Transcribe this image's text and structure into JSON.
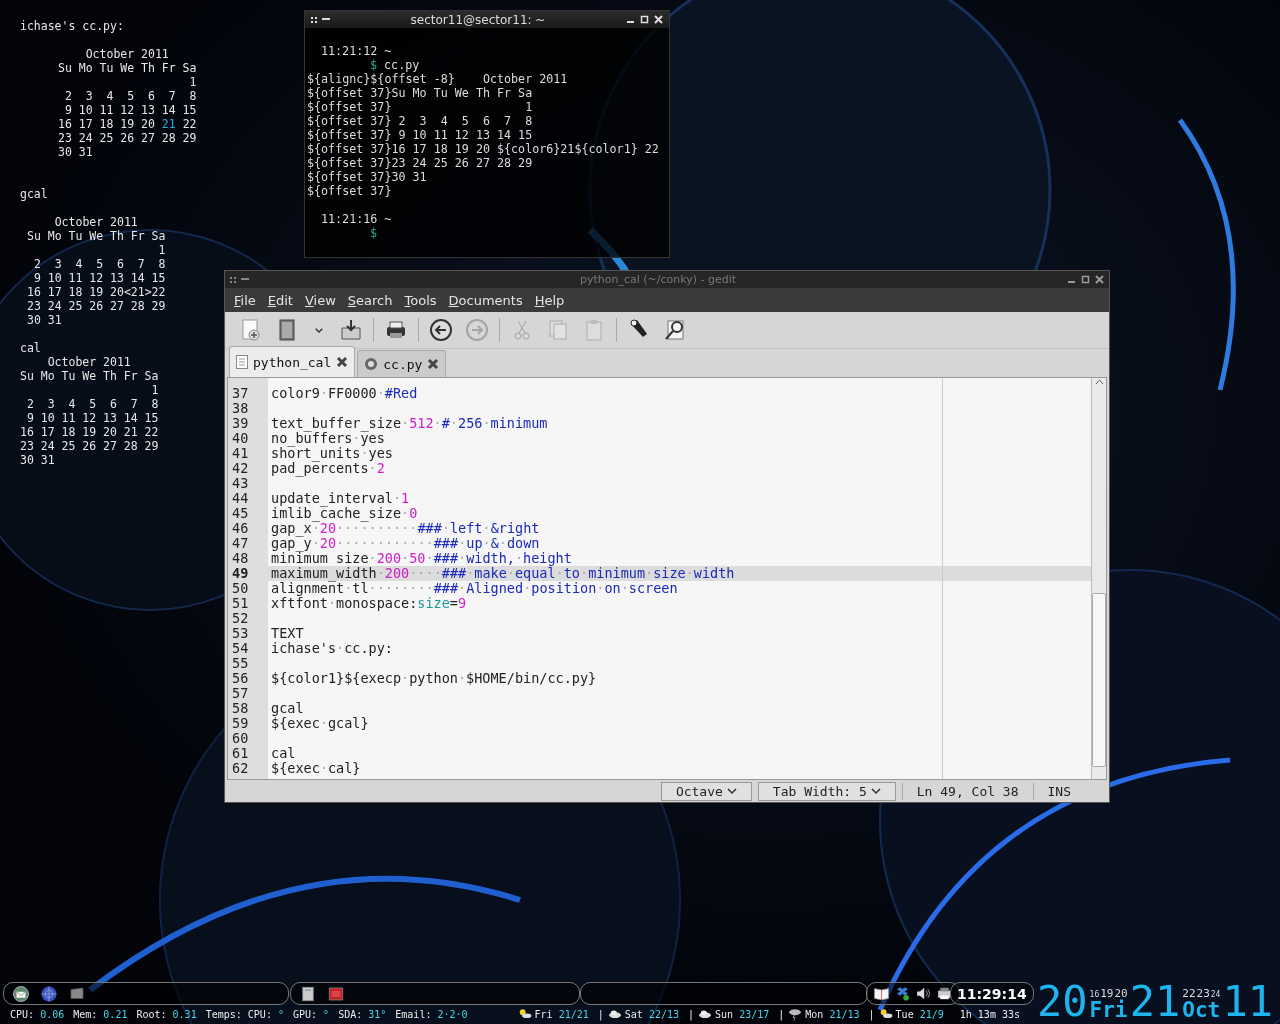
{
  "conky": {
    "sections": [
      {
        "title": "ichase's cc.py:",
        "calendar": [
          [
            "    October 2011"
          ],
          [
            "Su Mo Tu We Th Fr Sa"
          ],
          [
            "                   1"
          ],
          [
            " 2  3  4  5  6  7  8"
          ],
          [
            " 9 10 11 12 13 14 15"
          ],
          [
            {
              "text": "16 17 18 19 20 ",
              "highlight": false
            },
            {
              "text": "21",
              "highlight": true
            },
            {
              "text": " 22",
              "highlight": false
            }
          ],
          [
            "23 24 25 26 27 28 29"
          ],
          [
            "30 31"
          ]
        ]
      },
      {
        "title": "gcal",
        "calendar": [
          [
            "    October 2011"
          ],
          [
            "Su Mo Tu We Th Fr Sa"
          ],
          [
            "                   1"
          ],
          [
            " 2  3  4  5  6  7  8"
          ],
          [
            " 9 10 11 12 13 14 15"
          ],
          [
            "16 17 18 19 20<21>22"
          ],
          [
            "23 24 25 26 27 28 29"
          ],
          [
            "30 31"
          ]
        ]
      },
      {
        "title": "cal",
        "calendar": [
          [
            "    October 2011"
          ],
          [
            "Su Mo Tu We Th Fr Sa"
          ],
          [
            "                   1"
          ],
          [
            " 2  3  4  5  6  7  8"
          ],
          [
            " 9 10 11 12 13 14 15"
          ],
          [
            "16 17 18 19 20 21 22"
          ],
          [
            "23 24 25 26 27 28 29"
          ],
          [
            "30 31"
          ]
        ]
      }
    ]
  },
  "terminal": {
    "title": "sector11@sector11: ~",
    "lines": [
      {
        "kind": "blank"
      },
      {
        "kind": "time",
        "text": "11:21:12 ~"
      },
      {
        "kind": "prompt",
        "prompt": "$",
        "text": "cc.py"
      },
      {
        "kind": "output",
        "text": "${alignc}${offset -8}    October 2011"
      },
      {
        "kind": "output",
        "text": "${offset 37}Su Mo Tu We Th Fr Sa"
      },
      {
        "kind": "output",
        "text": "${offset 37}                   1"
      },
      {
        "kind": "output",
        "text": "${offset 37} 2  3  4  5  6  7  8"
      },
      {
        "kind": "output",
        "text": "${offset 37} 9 10 11 12 13 14 15"
      },
      {
        "kind": "output",
        "text": "${offset 37}16 17 18 19 20 ${color6}21${color1} 22"
      },
      {
        "kind": "output",
        "text": "${offset 37}23 24 25 26 27 28 29"
      },
      {
        "kind": "output",
        "text": "${offset 37}30 31"
      },
      {
        "kind": "output",
        "text": "${offset 37}"
      },
      {
        "kind": "blank"
      },
      {
        "kind": "time",
        "text": "11:21:16 ~"
      },
      {
        "kind": "prompt",
        "prompt": "$"
      }
    ]
  },
  "gedit": {
    "title": "python_cal (~/conky) - gedit",
    "menus": [
      "File",
      "Edit",
      "View",
      "Search",
      "Tools",
      "Documents",
      "Help"
    ],
    "toolbar": [
      [
        {
          "kind": "new",
          "disabled": false
        },
        {
          "kind": "open",
          "disabled": false
        },
        {
          "kind": "dropdown",
          "disabled": false
        },
        {
          "kind": "save",
          "disabled": false
        }
      ],
      [
        {
          "kind": "print",
          "disabled": false
        }
      ],
      [
        {
          "kind": "undo",
          "disabled": false
        },
        {
          "kind": "redo",
          "disabled": true
        }
      ],
      [
        {
          "kind": "cut",
          "disabled": true
        },
        {
          "kind": "copy",
          "disabled": true
        },
        {
          "kind": "paste",
          "disabled": true
        }
      ],
      [
        {
          "kind": "find",
          "disabled": false
        },
        {
          "kind": "replace",
          "disabled": false
        }
      ]
    ],
    "tabs": [
      {
        "label": "python_cal",
        "kind": "text",
        "selected": true
      },
      {
        "label": "cc.py",
        "kind": "python",
        "selected": false
      }
    ],
    "lines": [
      {
        "number": "37",
        "current": false,
        "tokens": [
          {
            "kind": "plain",
            "text": "color9·FF0000·"
          },
          {
            "kind": "comment",
            "text": "#Red"
          }
        ]
      },
      {
        "number": "38",
        "current": false
      },
      {
        "number": "39",
        "current": false,
        "tokens": [
          {
            "kind": "plain",
            "text": "text_buffer_size·"
          },
          {
            "kind": "number",
            "text": "512"
          },
          {
            "kind": "plain",
            "text": "·"
          },
          {
            "kind": "comment",
            "text": "#·256·minimum"
          }
        ]
      },
      {
        "number": "40",
        "current": false,
        "tokens": [
          {
            "kind": "plain",
            "text": "no_buffers·yes"
          }
        ]
      },
      {
        "number": "41",
        "current": false,
        "tokens": [
          {
            "kind": "plain",
            "text": "short_units·yes"
          }
        ]
      },
      {
        "number": "42",
        "current": false,
        "tokens": [
          {
            "kind": "plain",
            "text": "pad_percents·"
          },
          {
            "kind": "number",
            "text": "2"
          }
        ]
      },
      {
        "number": "43",
        "current": false
      },
      {
        "number": "44",
        "current": false,
        "tokens": [
          {
            "kind": "plain",
            "text": "update_interval·"
          },
          {
            "kind": "number",
            "text": "1"
          }
        ]
      },
      {
        "number": "45",
        "current": false,
        "tokens": [
          {
            "kind": "plain",
            "text": "imlib_cache_size·"
          },
          {
            "kind": "number",
            "text": "0"
          }
        ]
      },
      {
        "number": "46",
        "current": false,
        "tokens": [
          {
            "kind": "plain",
            "text": "gap_x·"
          },
          {
            "kind": "number",
            "text": "20"
          },
          {
            "kind": "plain",
            "text": "··········"
          },
          {
            "kind": "comment",
            "text": "###·left·&right"
          }
        ]
      },
      {
        "number": "47",
        "current": false,
        "tokens": [
          {
            "kind": "plain",
            "text": "gap_y·"
          },
          {
            "kind": "number",
            "text": "20"
          },
          {
            "kind": "plain",
            "text": "············"
          },
          {
            "kind": "comment",
            "text": "###·up·&·down"
          }
        ]
      },
      {
        "number": "48",
        "current": false,
        "tokens": [
          {
            "kind": "plain",
            "text": "minimum_size·"
          },
          {
            "kind": "number",
            "text": "200·50"
          },
          {
            "kind": "plain",
            "text": "·"
          },
          {
            "kind": "comment",
            "text": "###·width,·height"
          }
        ]
      },
      {
        "number": "49",
        "current": true,
        "tokens": [
          {
            "kind": "plain",
            "text": "maximum_width·"
          },
          {
            "kind": "number",
            "text": "200"
          },
          {
            "kind": "plain",
            "text": "····"
          },
          {
            "kind": "comment",
            "text": "###·make·equal·to·minimum·size·width"
          }
        ]
      },
      {
        "number": "50",
        "current": false,
        "tokens": [
          {
            "kind": "plain",
            "text": "alignment·tl········"
          },
          {
            "kind": "comment",
            "text": "###·Aligned·position·on·screen"
          }
        ]
      },
      {
        "number": "51",
        "current": false,
        "tokens": [
          {
            "kind": "plain",
            "text": "xftfont·monospace:"
          },
          {
            "kind": "keyword",
            "text": "size"
          },
          {
            "kind": "plain",
            "text": "="
          },
          {
            "kind": "number",
            "text": "9"
          }
        ]
      },
      {
        "number": "52",
        "current": false
      },
      {
        "number": "53",
        "current": false,
        "tokens": [
          {
            "kind": "plain",
            "text": "TEXT"
          }
        ]
      },
      {
        "number": "54",
        "current": false,
        "tokens": [
          {
            "kind": "plain",
            "text": "ichase's·cc.py:"
          }
        ]
      },
      {
        "number": "55",
        "current": false
      },
      {
        "number": "56",
        "current": false,
        "tokens": [
          {
            "kind": "plain",
            "text": "${color1}${execp·python·$HOME/bin/cc.py}"
          }
        ]
      },
      {
        "number": "57",
        "current": false
      },
      {
        "number": "58",
        "current": false,
        "tokens": [
          {
            "kind": "plain",
            "text": "gcal"
          }
        ]
      },
      {
        "number": "59",
        "current": false,
        "tokens": [
          {
            "kind": "plain",
            "text": "${exec·gcal}"
          }
        ]
      },
      {
        "number": "60",
        "current": false
      },
      {
        "number": "61",
        "current": false,
        "tokens": [
          {
            "kind": "plain",
            "text": "cal"
          }
        ]
      },
      {
        "number": "62",
        "current": false,
        "tokens": [
          {
            "kind": "plain",
            "text": "${exec·cal}"
          }
        ]
      }
    ],
    "status": [
      {
        "kind": "dropdown",
        "text": "Octave"
      },
      {
        "kind": "dropdown",
        "text": "Tab Width: 5"
      },
      {
        "kind": "text",
        "text": "Ln 49, Col 38"
      },
      {
        "kind": "text",
        "text": "INS"
      }
    ]
  },
  "taskbar": {
    "clock": "11:29:14"
  },
  "status_line": {
    "stats": [
      {
        "label": "CPU:",
        "value": "0.06"
      },
      {
        "label": "Mem:",
        "value": "0.21"
      },
      {
        "label": "Root:",
        "value": "0.31"
      },
      {
        "label": "Temps: CPU:",
        "value": "°"
      },
      {
        "label": "GPU:",
        "value": "°"
      },
      {
        "label": "SDA:",
        "value": "31°"
      },
      {
        "label": "Email:",
        "value": "2·2·0"
      }
    ],
    "forecast": [
      {
        "kind": "sun-cloud",
        "day": "Fri",
        "temps": "21/21",
        "sep": "|"
      },
      {
        "kind": "cloud",
        "day": "Sat",
        "temps": "22/13",
        "sep": "|"
      },
      {
        "kind": "cloud",
        "day": "Sun",
        "temps": "23/17",
        "sep": "|"
      },
      {
        "kind": "storm",
        "day": "Mon",
        "temps": "21/13",
        "sep": "|"
      },
      {
        "kind": "sun-cloud",
        "day": "Tue",
        "temps": "21/9"
      }
    ],
    "uptime": "1h 13m 33s"
  },
  "big_clock": [
    {
      "kind": "big",
      "text": "20"
    },
    {
      "kind": "stack",
      "small": [
        {
          "text": "16",
          "tiny": true
        },
        {
          "text": "19",
          "tiny": false
        },
        {
          "text": "20",
          "tiny": false
        }
      ],
      "word": "Fri"
    },
    {
      "kind": "big",
      "text": "21"
    },
    {
      "kind": "stack",
      "small": [
        {
          "text": "22",
          "tiny": false
        },
        {
          "text": "23",
          "tiny": false
        },
        {
          "text": "24",
          "tiny": true
        }
      ],
      "word": "Oct"
    },
    {
      "kind": "big",
      "text": "11"
    }
  ]
}
